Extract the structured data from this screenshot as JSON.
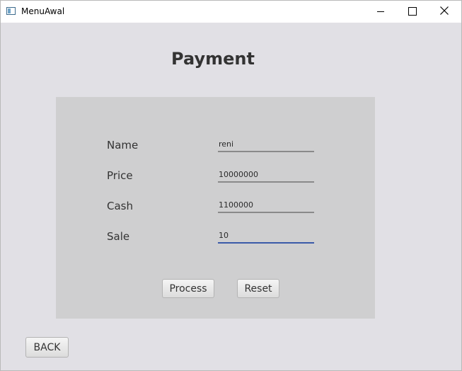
{
  "window": {
    "title": "MenuAwal"
  },
  "page": {
    "title": "Payment"
  },
  "form": {
    "fields": [
      {
        "label": "Name",
        "value": "reni"
      },
      {
        "label": "Price",
        "value": "10000000"
      },
      {
        "label": "Cash",
        "value": "1100000"
      },
      {
        "label": "Sale",
        "value": "10"
      }
    ],
    "focused_field": "Sale"
  },
  "buttons": {
    "process": "Process",
    "reset": "Reset",
    "back": "BACK"
  },
  "colors": {
    "background": "#e1e0e5",
    "panel": "#cfcfd0",
    "focus_underline": "#3a5aa8"
  },
  "icons": {
    "app": "java-window-icon",
    "minimize": "minimize-icon",
    "maximize": "maximize-icon",
    "close": "close-icon"
  }
}
